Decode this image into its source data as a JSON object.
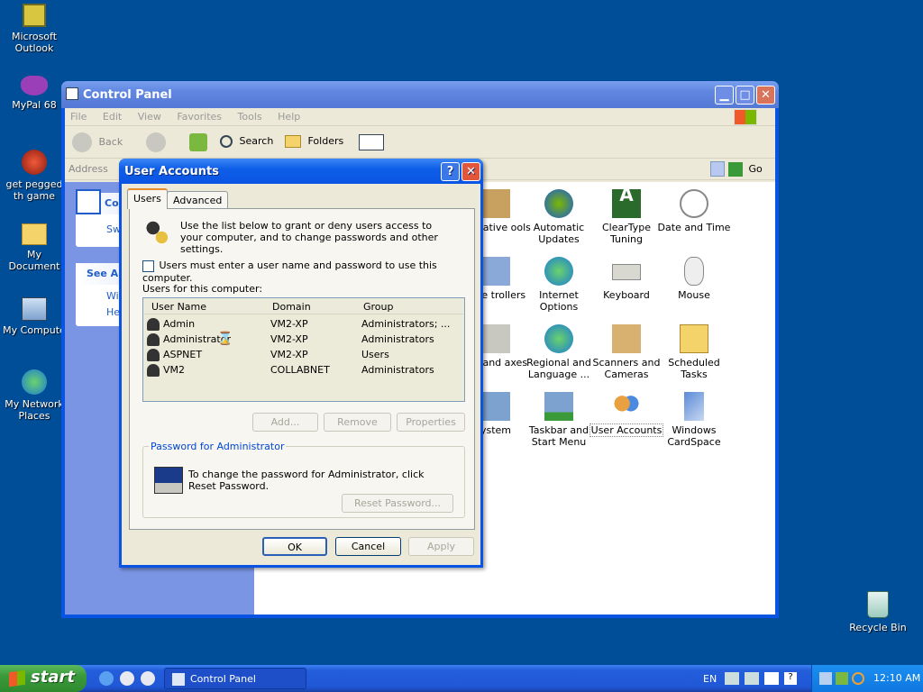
{
  "desktop": {
    "icons": [
      {
        "label": "Microsoft Outlook",
        "icon": "outlook-icon"
      },
      {
        "label": "MyPal 68",
        "icon": "mypal-icon"
      },
      {
        "label": "get pegged th game",
        "icon": "game-icon"
      },
      {
        "label": "My Document",
        "icon": "documents-icon"
      },
      {
        "label": "My Compute",
        "icon": "computer-icon"
      },
      {
        "label": "My Network Places",
        "icon": "network-icon"
      },
      {
        "label": "Recycle Bin",
        "icon": "recycle-bin-icon"
      }
    ]
  },
  "control_panel": {
    "title": "Control Panel",
    "menu": [
      "File",
      "Edit",
      "View",
      "Favorites",
      "Tools",
      "Help"
    ],
    "toolbar": {
      "back": "Back",
      "search": "Search",
      "folders": "Folders"
    },
    "address_label": "Address",
    "go_label": "Go",
    "left_pane": {
      "section1_title": "Co",
      "switch_label": "Sw",
      "see_also": "See Al",
      "link1": "Wi",
      "link2": "He"
    },
    "items": [
      {
        "label": "nistrative ools"
      },
      {
        "label": "Automatic Updates"
      },
      {
        "label": "ClearType Tuning"
      },
      {
        "label": "Date and Time"
      },
      {
        "label": "ame trollers"
      },
      {
        "label": "Internet Options"
      },
      {
        "label": "Keyboard"
      },
      {
        "label": "Mouse"
      },
      {
        "label": "ers and axes"
      },
      {
        "label": "Regional and Language ..."
      },
      {
        "label": "Scanners and Cameras"
      },
      {
        "label": "Scheduled Tasks"
      },
      {
        "label": "ystem"
      },
      {
        "label": "Taskbar and Start Menu"
      },
      {
        "label": "User Accounts"
      },
      {
        "label": "Windows CardSpace"
      }
    ]
  },
  "dialog": {
    "title": "User Accounts",
    "help_button": "?",
    "tabs": [
      "Users",
      "Advanced"
    ],
    "intro_text": "Use the list below to grant or deny users access to your computer, and to change passwords and other settings.",
    "checkbox_label": "Users must enter a user name and password to use this computer.",
    "checkbox_checked": false,
    "list_label": "Users for this computer:",
    "columns": [
      "User Name",
      "Domain",
      "Group"
    ],
    "users": [
      {
        "name": "Admin",
        "domain": "VM2-XP",
        "group": "Administrators; ..."
      },
      {
        "name": "Administrator",
        "domain": "VM2-XP",
        "group": "Administrators"
      },
      {
        "name": "ASPNET",
        "domain": "VM2-XP",
        "group": "Users"
      },
      {
        "name": "VM2",
        "domain": "COLLABNET",
        "group": "Administrators"
      }
    ],
    "list_buttons": {
      "add": "Add...",
      "remove": "Remove",
      "properties": "Properties"
    },
    "password_group": "Password for Administrator",
    "password_text": "To change the password for Administrator, click Reset Password.",
    "reset_button": "Reset Password...",
    "ok": "OK",
    "cancel": "Cancel",
    "apply": "Apply"
  },
  "taskbar": {
    "start_label": "start",
    "task_label": "Control Panel",
    "language": "EN",
    "clock": "12:10 AM"
  }
}
